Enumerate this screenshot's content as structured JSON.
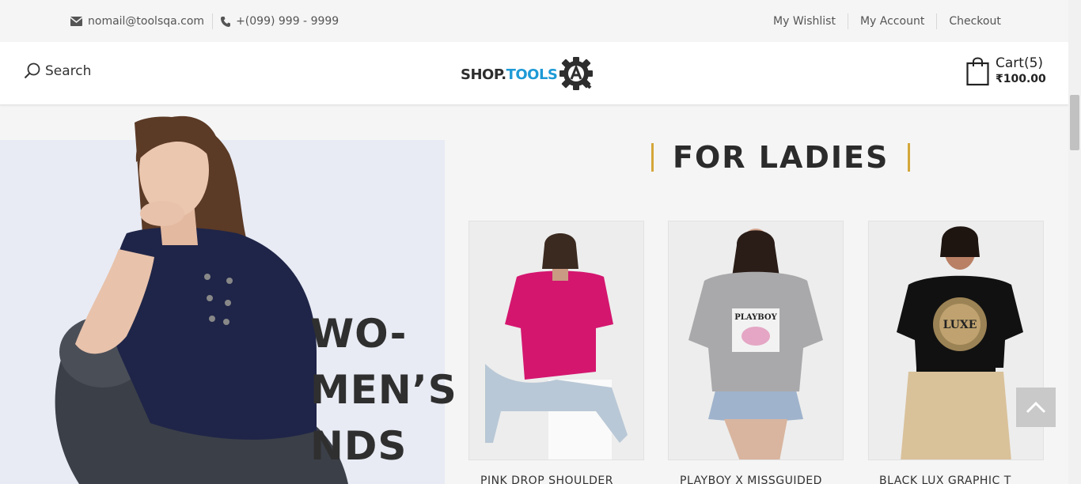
{
  "topbar": {
    "email": "nomail@toolsqa.com",
    "phone": "+(099) 999 - 9999",
    "links": [
      "My Wishlist",
      "My Account",
      "Checkout"
    ]
  },
  "header": {
    "search_label": "Search",
    "logo_shop": "SHOP.",
    "logo_tools": "TOOLS",
    "cart_label": "Cart(5)",
    "cart_total": "₹100.00"
  },
  "banner": {
    "lines": [
      "WO-",
      "MEN’S",
      "NDS"
    ]
  },
  "ladies": {
    "title": "FOR LADIES",
    "products": [
      {
        "name": "PINK DROP SHOULDER",
        "shirt_color": "#d4166f"
      },
      {
        "name": "PLAYBOY X MISSGUIDED",
        "shirt_color": "#a9a9ab"
      },
      {
        "name": "BLACK LUX GRAPHIC T",
        "shirt_color": "#111111"
      }
    ]
  },
  "colors": {
    "accent_gold": "#d4a73a",
    "brand_blue": "#1e9ad6",
    "banner_bg": "#e8ebf4"
  }
}
